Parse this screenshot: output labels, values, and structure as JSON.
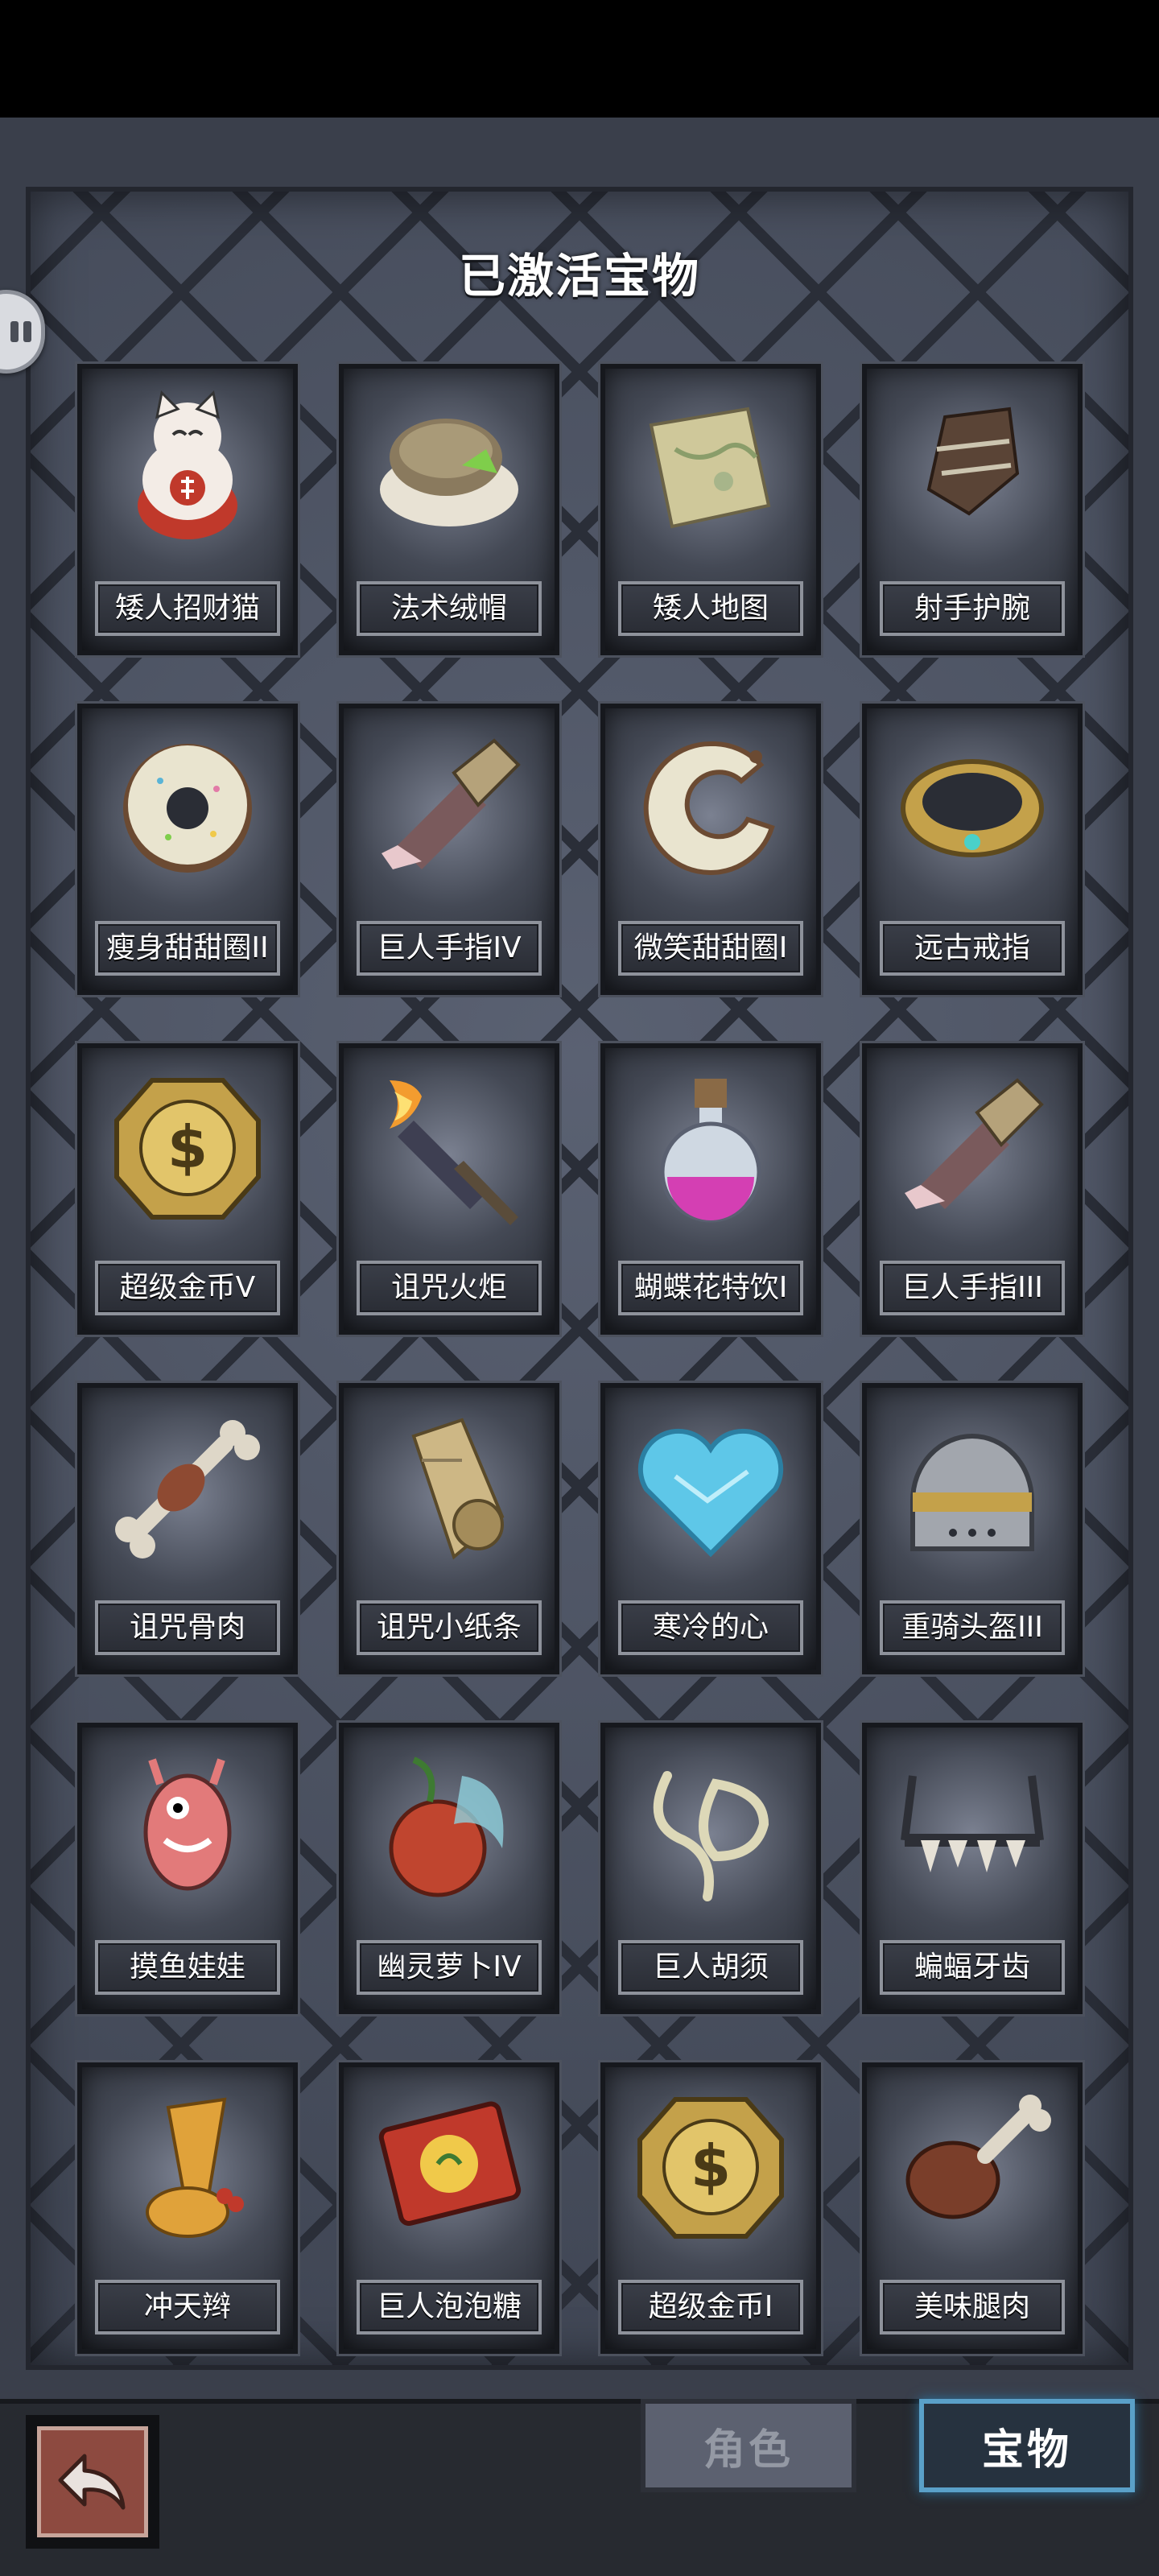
{
  "panel": {
    "title": "已激活宝物"
  },
  "items": [
    {
      "label": "矮人招财猫",
      "icon": "lucky-cat-icon"
    },
    {
      "label": "法术绒帽",
      "icon": "fur-hat-icon"
    },
    {
      "label": "矮人地图",
      "icon": "map-scroll-icon"
    },
    {
      "label": "射手护腕",
      "icon": "bracer-icon"
    },
    {
      "label": "瘦身甜甜圈II",
      "icon": "donut-icon"
    },
    {
      "label": "巨人手指IV",
      "icon": "giant-finger-icon"
    },
    {
      "label": "微笑甜甜圈I",
      "icon": "bitten-donut-icon"
    },
    {
      "label": "远古戒指",
      "icon": "ring-icon"
    },
    {
      "label": "超级金币V",
      "icon": "gold-coin-icon"
    },
    {
      "label": "诅咒火炬",
      "icon": "torch-icon"
    },
    {
      "label": "蝴蝶花特饮I",
      "icon": "potion-icon"
    },
    {
      "label": "巨人手指III",
      "icon": "giant-finger-icon"
    },
    {
      "label": "诅咒骨肉",
      "icon": "bone-meat-icon"
    },
    {
      "label": "诅咒小纸条",
      "icon": "paper-scroll-icon"
    },
    {
      "label": "寒冷的心",
      "icon": "ice-heart-icon"
    },
    {
      "label": "重骑头盔III",
      "icon": "helmet-icon"
    },
    {
      "label": "摸鱼娃娃",
      "icon": "doll-icon"
    },
    {
      "label": "幽灵萝卜IV",
      "icon": "ghost-radish-icon"
    },
    {
      "label": "巨人胡须",
      "icon": "beard-icon"
    },
    {
      "label": "蝙蝠牙齿",
      "icon": "bat-teeth-icon"
    },
    {
      "label": "冲天辫",
      "icon": "pigtail-icon"
    },
    {
      "label": "巨人泡泡糖",
      "icon": "bubblegum-icon"
    },
    {
      "label": "超级金币I",
      "icon": "gold-coin-icon"
    },
    {
      "label": "美味腿肉",
      "icon": "drumstick-icon"
    }
  ],
  "bottom_nav": {
    "back": {
      "icon": "return-arrow-icon"
    },
    "tabs": [
      {
        "label": "角色",
        "active": false
      },
      {
        "label": "宝物",
        "active": true
      }
    ]
  }
}
